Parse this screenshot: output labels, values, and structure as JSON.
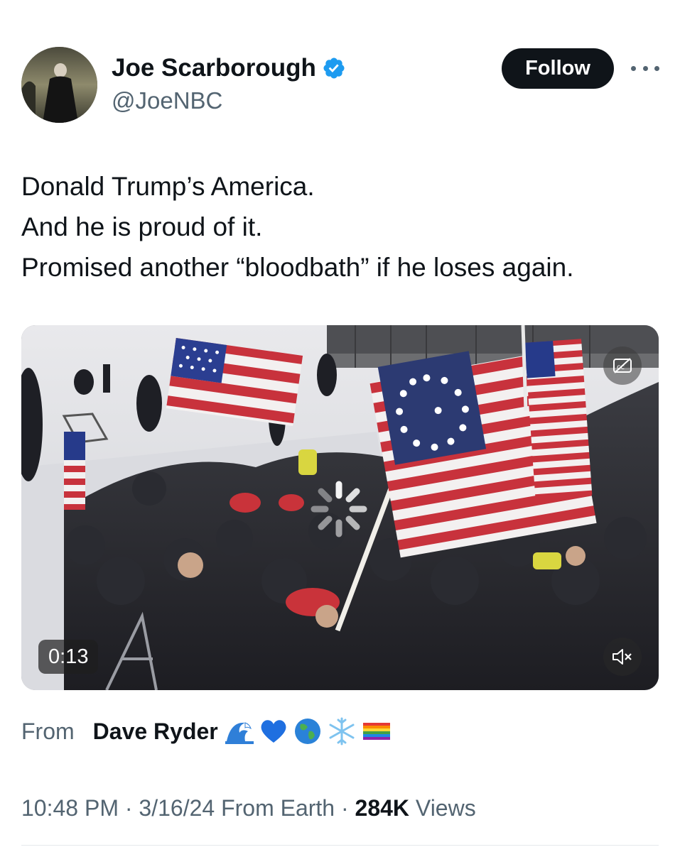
{
  "author": {
    "name": "Joe Scarborough",
    "handle": "@JoeNBC",
    "verified": true,
    "avatar_icon": "profile-photo"
  },
  "actions": {
    "follow_label": "Follow",
    "more_icon": "more-dots-icon"
  },
  "tweet": {
    "lines": [
      "Donald Trump’s America.",
      "And he is proud of it.",
      "Promised another “bloodbath” if he loses again."
    ]
  },
  "video": {
    "time": "0:13",
    "captions_icon": "closed-captions-icon",
    "loading_icon": "loading-spinner-icon",
    "mute_icon": "muted-speaker-icon"
  },
  "attribution": {
    "from_label": "From",
    "author": "Dave Ryder",
    "emojis": [
      "wave-emoji",
      "blue-heart-emoji",
      "globe-emoji",
      "snowflake-emoji",
      "rainbow-flag-emoji"
    ]
  },
  "meta": {
    "time": "10:48 PM",
    "sep1": " · ",
    "date": "3/16/24",
    "source": " From Earth",
    "sep2": " · ",
    "views_count": "284K",
    "views_label": " Views"
  },
  "colors": {
    "verified": "#1d9bf0",
    "text_primary": "#0f1419",
    "text_secondary": "#536471",
    "follow_bg": "#0f1419"
  }
}
